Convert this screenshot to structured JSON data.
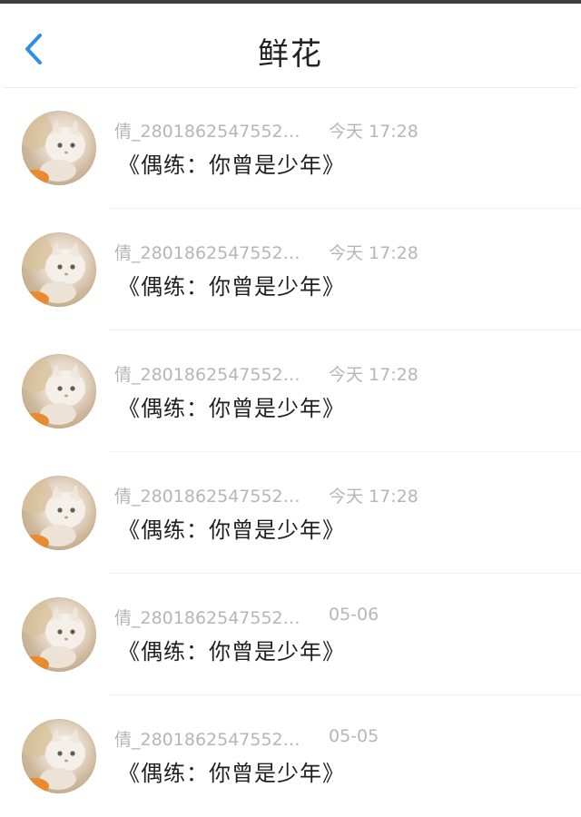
{
  "header": {
    "title": "鲜花",
    "back_icon": "chevron-left-icon",
    "accent_color": "#2f8ee8"
  },
  "items": [
    {
      "sender": "倩_280186254755297...",
      "time": "今天 17:28",
      "gift": "《偶练：你曾是少年》"
    },
    {
      "sender": "倩_280186254755297...",
      "time": "今天 17:28",
      "gift": "《偶练：你曾是少年》"
    },
    {
      "sender": "倩_280186254755297...",
      "time": "今天 17:28",
      "gift": "《偶练：你曾是少年》"
    },
    {
      "sender": "倩_280186254755297...",
      "time": "今天 17:28",
      "gift": "《偶练：你曾是少年》"
    },
    {
      "sender": "倩_280186254755297...",
      "time": "05-06",
      "gift": "《偶练：你曾是少年》"
    },
    {
      "sender": "倩_280186254755297...",
      "time": "05-05",
      "gift": "《偶练：你曾是少年》"
    }
  ]
}
